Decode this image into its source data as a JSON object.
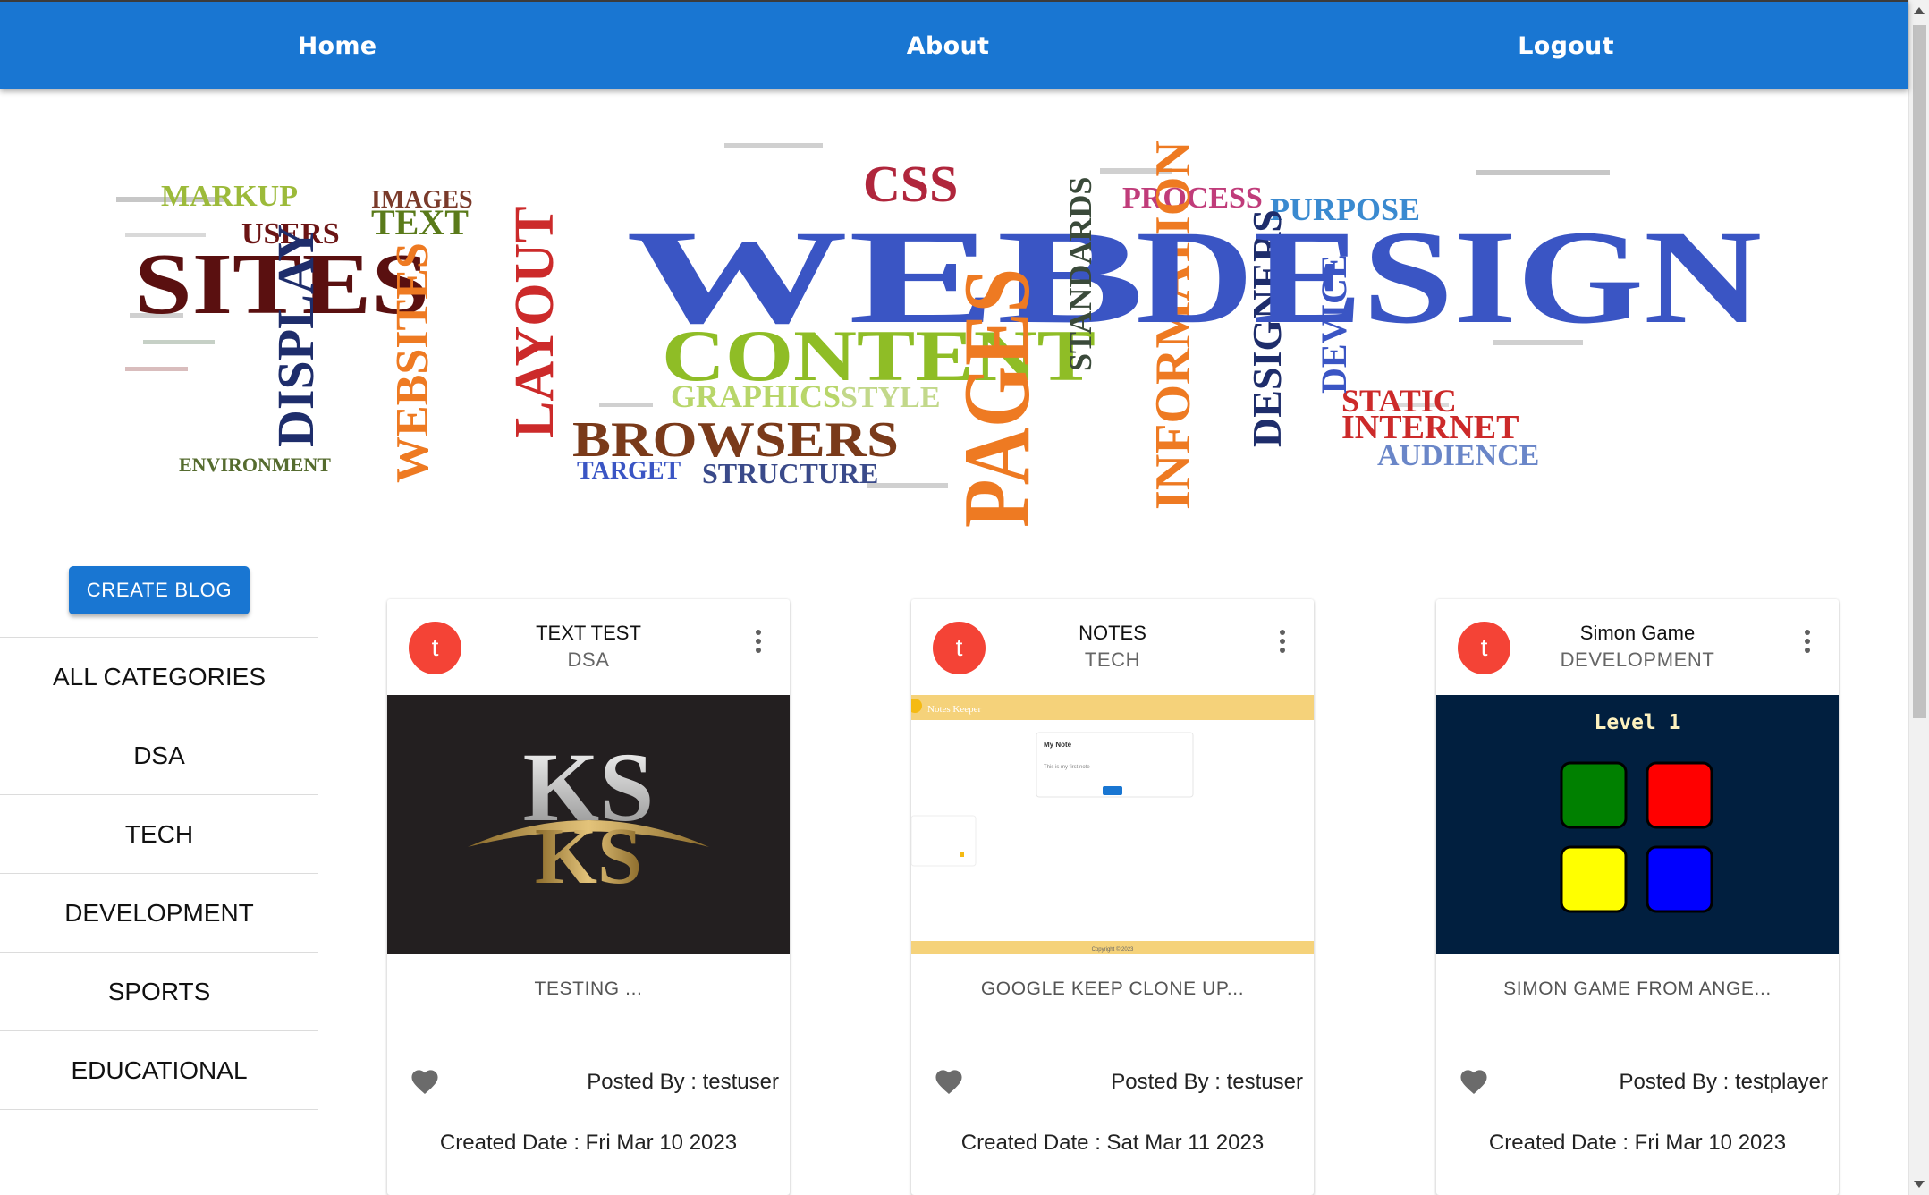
{
  "nav": {
    "home": "Home",
    "about": "About",
    "logout": "Logout"
  },
  "banner": {
    "words": {
      "web_design": "WEB DESIGN",
      "sites": "SITES",
      "content": "CONTENT",
      "css": "CSS",
      "browsers": "BROWSERS",
      "structure": "STRUCTURE",
      "target": "TARGET",
      "users": "USERS",
      "text": "TEXT",
      "markup": "MARKUP",
      "images": "IMAGES",
      "process": "PROCESS",
      "purpose": "PURPOSE",
      "internet": "INTERNET",
      "audience": "AUDIENCE",
      "static": "STATIC",
      "graphics": "GRAPHICS",
      "style": "STYLE",
      "display": "DISPLAY",
      "websites": "WEBSITES",
      "layout": "LAYOUT",
      "pages": "PAGES",
      "information": "INFORMATION",
      "designers": "DESIGNERS",
      "device": "DEVICE",
      "standards": "STANDARDS",
      "environment": "ENVIRONMENT"
    },
    "colors": {
      "blue": "#3a55c4",
      "orange": "#ee7a22",
      "green": "#8fbd26",
      "darkred": "#6b1414",
      "navy": "#1e2d6b",
      "red": "#cc2a2a",
      "gray": "#555555"
    }
  },
  "sidebar": {
    "create_button": "CREATE BLOG",
    "categories": [
      "ALL CATEGORIES",
      "DSA",
      "TECH",
      "DEVELOPMENT",
      "SPORTS",
      "EDUCATIONAL"
    ]
  },
  "cards": [
    {
      "avatar": "t",
      "title": "TEXT TEST",
      "category": "DSA",
      "description": "TESTING ...",
      "posted_by": "Posted By : testuser",
      "created_date": "Created Date : Fri Mar 10 2023",
      "media": {
        "logo_text": "KS"
      }
    },
    {
      "avatar": "t",
      "title": "NOTES",
      "category": "TECH",
      "description": "GOOGLE KEEP CLONE UP...",
      "posted_by": "Posted By : testuser",
      "created_date": "Created Date : Sat Mar 11 2023",
      "media": {
        "header": "Notes Keeper",
        "note_title": "My Note",
        "note_body": "This is my first note",
        "footer": "Copyright © 2023"
      }
    },
    {
      "avatar": "t",
      "title": "Simon Game",
      "category": "DEVELOPMENT",
      "description": "SIMON GAME FROM ANGE...",
      "posted_by": "Posted By : testplayer",
      "created_date": "Created Date : Fri Mar 10 2023",
      "media": {
        "level": "Level 1",
        "colors": [
          "#008000",
          "#ff0000",
          "#ffff00",
          "#0000ff"
        ]
      }
    }
  ],
  "theme": {
    "primary": "#1976d2",
    "avatar": "#f44336"
  }
}
